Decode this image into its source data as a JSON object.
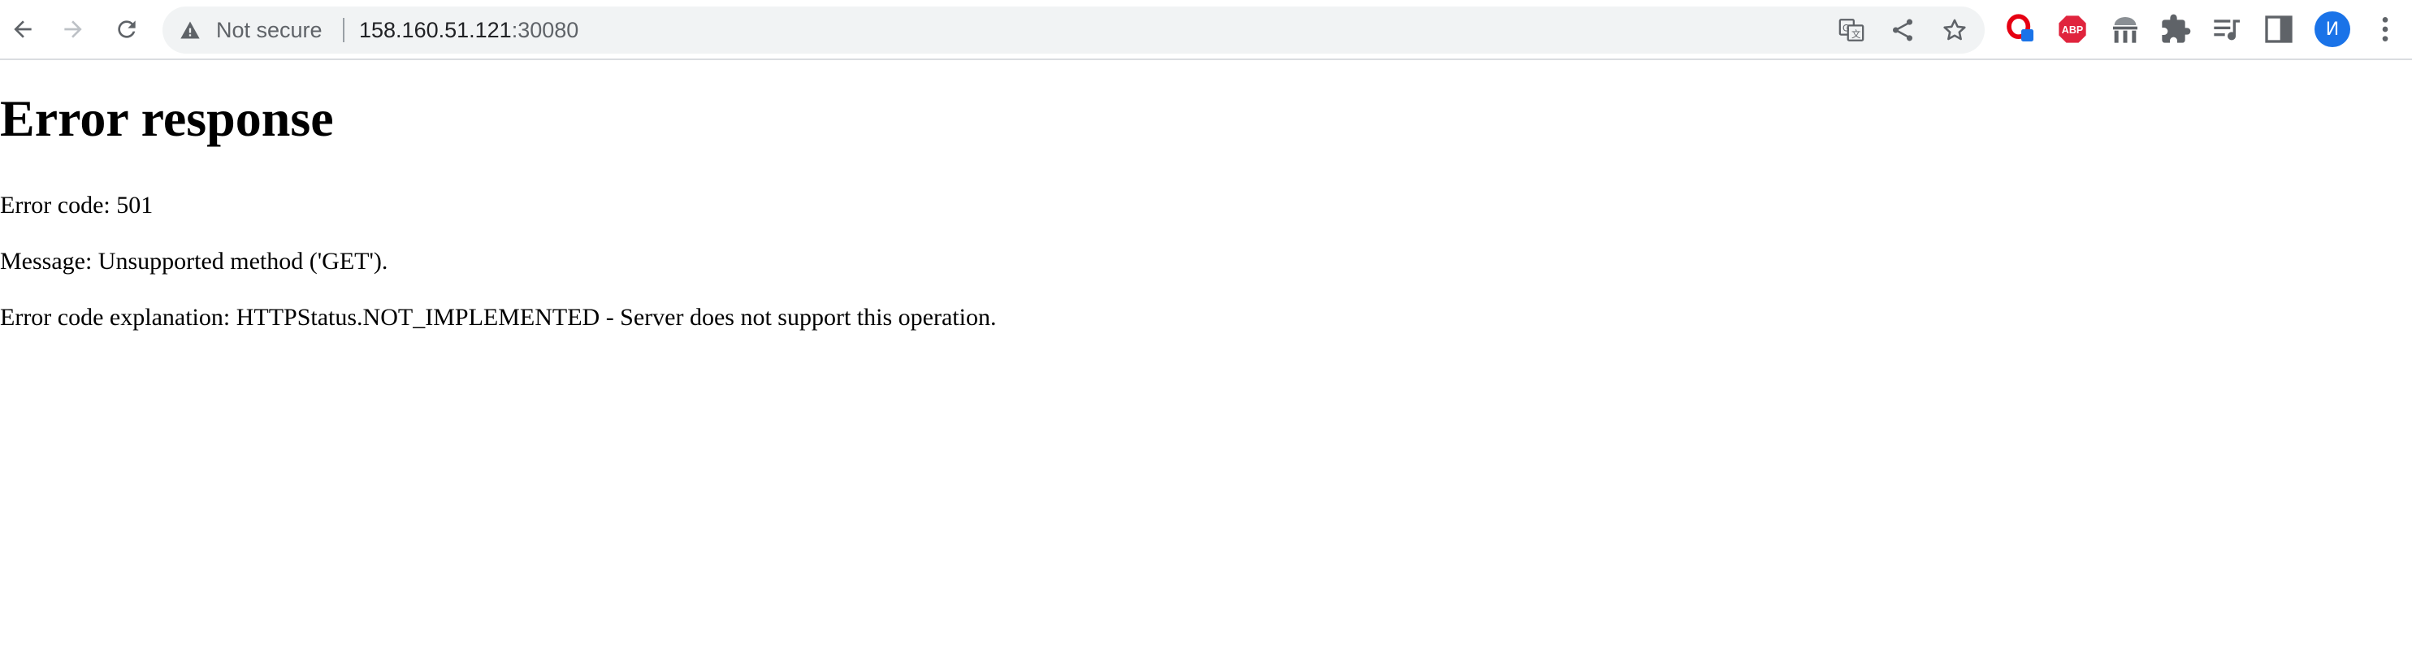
{
  "browser": {
    "security_status": "Not secure",
    "url_host": "158.160.51.121",
    "url_port": ":30080",
    "toolbar_icons": [
      "back-arrow-icon",
      "forward-arrow-icon",
      "reload-icon",
      "warning-icon",
      "translate-icon",
      "share-icon",
      "star-icon"
    ],
    "extensions": {
      "abp_label": "ABP",
      "avatar_letter": "И",
      "icons": [
        "opera-icon",
        "adblock-plus-icon",
        "museum-icon",
        "puzzle-icon",
        "media-queue-icon",
        "side-panel-icon",
        "avatar",
        "kebab-menu-icon"
      ]
    },
    "colors": {
      "abp_red": "#e0243d",
      "opera_red": "#e60012",
      "avatar_blue": "#1a73e8",
      "toolbar_border": "#dadce0"
    }
  },
  "page": {
    "title": "Error response",
    "error_code_line": "Error code: 501",
    "message_line": "Message: Unsupported method ('GET').",
    "explanation_line": "Error code explanation: HTTPStatus.NOT_IMPLEMENTED - Server does not support this operation."
  }
}
